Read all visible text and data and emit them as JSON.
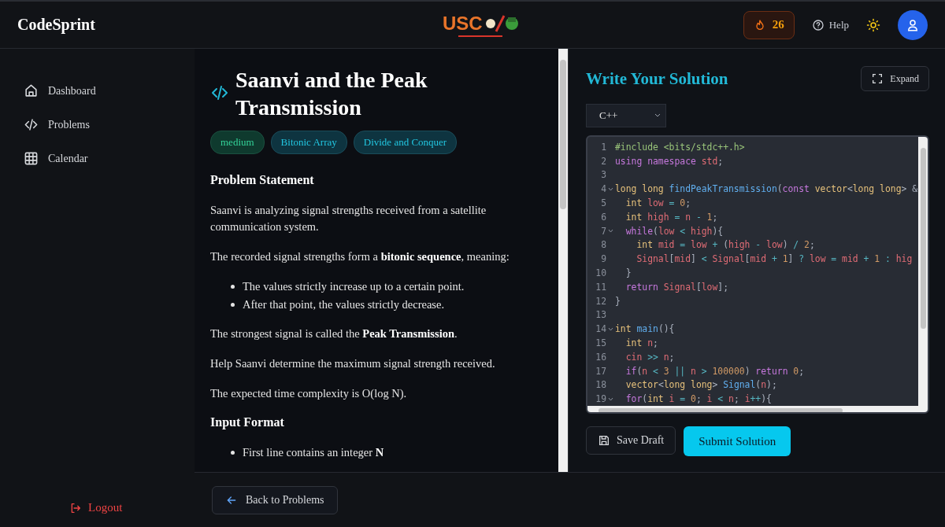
{
  "header": {
    "brand": "CodeSprint",
    "logo": {
      "mark": "USC"
    },
    "streak": "26",
    "help": "Help"
  },
  "sidebar": {
    "items": [
      {
        "label": "Dashboard",
        "kind": "home",
        "selected": false
      },
      {
        "label": "Problems",
        "kind": "code",
        "selected": false
      },
      {
        "label": "Calendar",
        "kind": "grid",
        "selected": false
      }
    ],
    "logout": "Logout"
  },
  "problem": {
    "title": "Saanvi and the Peak Transmission",
    "tags": [
      {
        "label": "medium",
        "kind": "difficulty"
      },
      {
        "label": "Bitonic Array",
        "kind": "topic"
      },
      {
        "label": "Divide and Conquer",
        "kind": "topic"
      }
    ],
    "sections": [
      {
        "kind": "heading",
        "text": "Problem Statement"
      },
      {
        "kind": "paragraph",
        "text": "Saanvi is analyzing signal strengths received from a satellite communication system."
      },
      {
        "kind": "paragraph",
        "text": "The recorded signal strengths form a **bitonic sequence**, meaning:"
      },
      {
        "kind": "list",
        "items": [
          "The values strictly increase up to a certain point.",
          "After that point, the values strictly decrease."
        ]
      },
      {
        "kind": "paragraph",
        "text": "The strongest signal is called the **Peak Transmission**."
      },
      {
        "kind": "paragraph",
        "text": "Help Saanvi determine the maximum signal strength received."
      },
      {
        "kind": "paragraph",
        "text": "The expected time complexity is O(log N)."
      },
      {
        "kind": "heading",
        "text": "Input Format"
      },
      {
        "kind": "list",
        "items": [
          "First line contains an integer **N**"
        ]
      }
    ]
  },
  "editor": {
    "title": "Write Your Solution",
    "expand": "Expand",
    "language": "C++",
    "lines": [
      {
        "n": "1",
        "fold": false,
        "tokens": [
          {
            "kind": "string",
            "text": "#include <bits/stdc++.h>"
          }
        ]
      },
      {
        "n": "2",
        "fold": false,
        "tokens": [
          {
            "kind": "keyword",
            "text": "using namespace "
          },
          {
            "kind": "variable",
            "text": "std"
          },
          {
            "kind": "punct",
            "text": ";"
          }
        ]
      },
      {
        "n": "3",
        "fold": false
      },
      {
        "n": "4",
        "fold": true,
        "tokens": [
          {
            "kind": "type",
            "text": "long long "
          },
          {
            "kind": "function",
            "text": "findPeakTransmission"
          },
          {
            "kind": "punct",
            "text": "("
          },
          {
            "kind": "keyword",
            "text": "const "
          },
          {
            "kind": "type",
            "text": "vector"
          },
          {
            "kind": "punct",
            "text": "<"
          },
          {
            "kind": "type",
            "text": "long long"
          },
          {
            "kind": "punct",
            "text": "> &"
          }
        ]
      },
      {
        "n": "5",
        "fold": false,
        "tokens": [
          {
            "kind": "type",
            "text": "  int "
          },
          {
            "kind": "variable",
            "text": "low"
          },
          {
            "kind": "operator",
            "text": " = "
          },
          {
            "kind": "number",
            "text": "0"
          },
          {
            "kind": "punct",
            "text": ";"
          }
        ]
      },
      {
        "n": "6",
        "fold": false,
        "tokens": [
          {
            "kind": "type",
            "text": "  int "
          },
          {
            "kind": "variable",
            "text": "high"
          },
          {
            "kind": "operator",
            "text": " = "
          },
          {
            "kind": "variable",
            "text": "n"
          },
          {
            "kind": "operator",
            "text": " - "
          },
          {
            "kind": "number",
            "text": "1"
          },
          {
            "kind": "punct",
            "text": ";"
          }
        ]
      },
      {
        "n": "7",
        "fold": true,
        "tokens": [
          {
            "kind": "keyword",
            "text": "  while"
          },
          {
            "kind": "punct",
            "text": "("
          },
          {
            "kind": "variable",
            "text": "low"
          },
          {
            "kind": "operator",
            "text": " < "
          },
          {
            "kind": "variable",
            "text": "high"
          },
          {
            "kind": "punct",
            "text": "){"
          }
        ]
      },
      {
        "n": "8",
        "fold": false,
        "tokens": [
          {
            "kind": "type",
            "text": "    int "
          },
          {
            "kind": "variable",
            "text": "mid"
          },
          {
            "kind": "operator",
            "text": " = "
          },
          {
            "kind": "variable",
            "text": "low"
          },
          {
            "kind": "operator",
            "text": " + "
          },
          {
            "kind": "punct",
            "text": "("
          },
          {
            "kind": "variable",
            "text": "high"
          },
          {
            "kind": "operator",
            "text": " - "
          },
          {
            "kind": "variable",
            "text": "low"
          },
          {
            "kind": "punct",
            "text": ")"
          },
          {
            "kind": "operator",
            "text": " / "
          },
          {
            "kind": "number",
            "text": "2"
          },
          {
            "kind": "punct",
            "text": ";"
          }
        ]
      },
      {
        "n": "9",
        "fold": false,
        "tokens": [
          {
            "kind": "variable",
            "text": "    Signal"
          },
          {
            "kind": "punct",
            "text": "["
          },
          {
            "kind": "variable",
            "text": "mid"
          },
          {
            "kind": "punct",
            "text": "]"
          },
          {
            "kind": "operator",
            "text": " < "
          },
          {
            "kind": "variable",
            "text": "Signal"
          },
          {
            "kind": "punct",
            "text": "["
          },
          {
            "kind": "variable",
            "text": "mid"
          },
          {
            "kind": "operator",
            "text": " + "
          },
          {
            "kind": "number",
            "text": "1"
          },
          {
            "kind": "punct",
            "text": "]"
          },
          {
            "kind": "operator",
            "text": " ? "
          },
          {
            "kind": "variable",
            "text": "low"
          },
          {
            "kind": "operator",
            "text": " = "
          },
          {
            "kind": "variable",
            "text": "mid"
          },
          {
            "kind": "operator",
            "text": " + "
          },
          {
            "kind": "number",
            "text": "1"
          },
          {
            "kind": "operator",
            "text": " : "
          },
          {
            "kind": "variable",
            "text": "hig"
          }
        ]
      },
      {
        "n": "10",
        "fold": false,
        "tokens": [
          {
            "kind": "punct",
            "text": "  }"
          }
        ]
      },
      {
        "n": "11",
        "fold": false,
        "tokens": [
          {
            "kind": "keyword",
            "text": "  return "
          },
          {
            "kind": "variable",
            "text": "Signal"
          },
          {
            "kind": "punct",
            "text": "["
          },
          {
            "kind": "variable",
            "text": "low"
          },
          {
            "kind": "punct",
            "text": "];"
          }
        ]
      },
      {
        "n": "12",
        "fold": false,
        "tokens": [
          {
            "kind": "punct",
            "text": "}"
          }
        ]
      },
      {
        "n": "13",
        "fold": false
      },
      {
        "n": "14",
        "fold": true,
        "tokens": [
          {
            "kind": "type",
            "text": "int "
          },
          {
            "kind": "function",
            "text": "main"
          },
          {
            "kind": "punct",
            "text": "(){"
          }
        ]
      },
      {
        "n": "15",
        "fold": false,
        "tokens": [
          {
            "kind": "type",
            "text": "  int "
          },
          {
            "kind": "variable",
            "text": "n"
          },
          {
            "kind": "punct",
            "text": ";"
          }
        ]
      },
      {
        "n": "16",
        "fold": false,
        "tokens": [
          {
            "kind": "variable",
            "text": "  cin"
          },
          {
            "kind": "operator",
            "text": " >> "
          },
          {
            "kind": "variable",
            "text": "n"
          },
          {
            "kind": "punct",
            "text": ";"
          }
        ]
      },
      {
        "n": "17",
        "fold": false,
        "tokens": [
          {
            "kind": "keyword",
            "text": "  if"
          },
          {
            "kind": "punct",
            "text": "("
          },
          {
            "kind": "variable",
            "text": "n"
          },
          {
            "kind": "operator",
            "text": " < "
          },
          {
            "kind": "number",
            "text": "3"
          },
          {
            "kind": "operator",
            "text": " || "
          },
          {
            "kind": "variable",
            "text": "n"
          },
          {
            "kind": "operator",
            "text": " > "
          },
          {
            "kind": "number",
            "text": "100000"
          },
          {
            "kind": "punct",
            "text": ") "
          },
          {
            "kind": "keyword",
            "text": "return "
          },
          {
            "kind": "number",
            "text": "0"
          },
          {
            "kind": "punct",
            "text": ";"
          }
        ]
      },
      {
        "n": "18",
        "fold": false,
        "tokens": [
          {
            "kind": "type",
            "text": "  vector"
          },
          {
            "kind": "punct",
            "text": "<"
          },
          {
            "kind": "type",
            "text": "long long"
          },
          {
            "kind": "punct",
            "text": "> "
          },
          {
            "kind": "function",
            "text": "Signal"
          },
          {
            "kind": "punct",
            "text": "("
          },
          {
            "kind": "variable",
            "text": "n"
          },
          {
            "kind": "punct",
            "text": ");"
          }
        ]
      },
      {
        "n": "19",
        "fold": true,
        "tokens": [
          {
            "kind": "keyword",
            "text": "  for"
          },
          {
            "kind": "punct",
            "text": "("
          },
          {
            "kind": "type",
            "text": "int "
          },
          {
            "kind": "variable",
            "text": "i"
          },
          {
            "kind": "operator",
            "text": " = "
          },
          {
            "kind": "number",
            "text": "0"
          },
          {
            "kind": "punct",
            "text": "; "
          },
          {
            "kind": "variable",
            "text": "i"
          },
          {
            "kind": "operator",
            "text": " < "
          },
          {
            "kind": "variable",
            "text": "n"
          },
          {
            "kind": "punct",
            "text": "; "
          },
          {
            "kind": "variable",
            "text": "i"
          },
          {
            "kind": "operator",
            "text": "++"
          },
          {
            "kind": "punct",
            "text": "){"
          }
        ]
      }
    ],
    "save": "Save Draft",
    "submit": "Submit Solution"
  },
  "footer": {
    "back": "Back to Problems"
  }
}
